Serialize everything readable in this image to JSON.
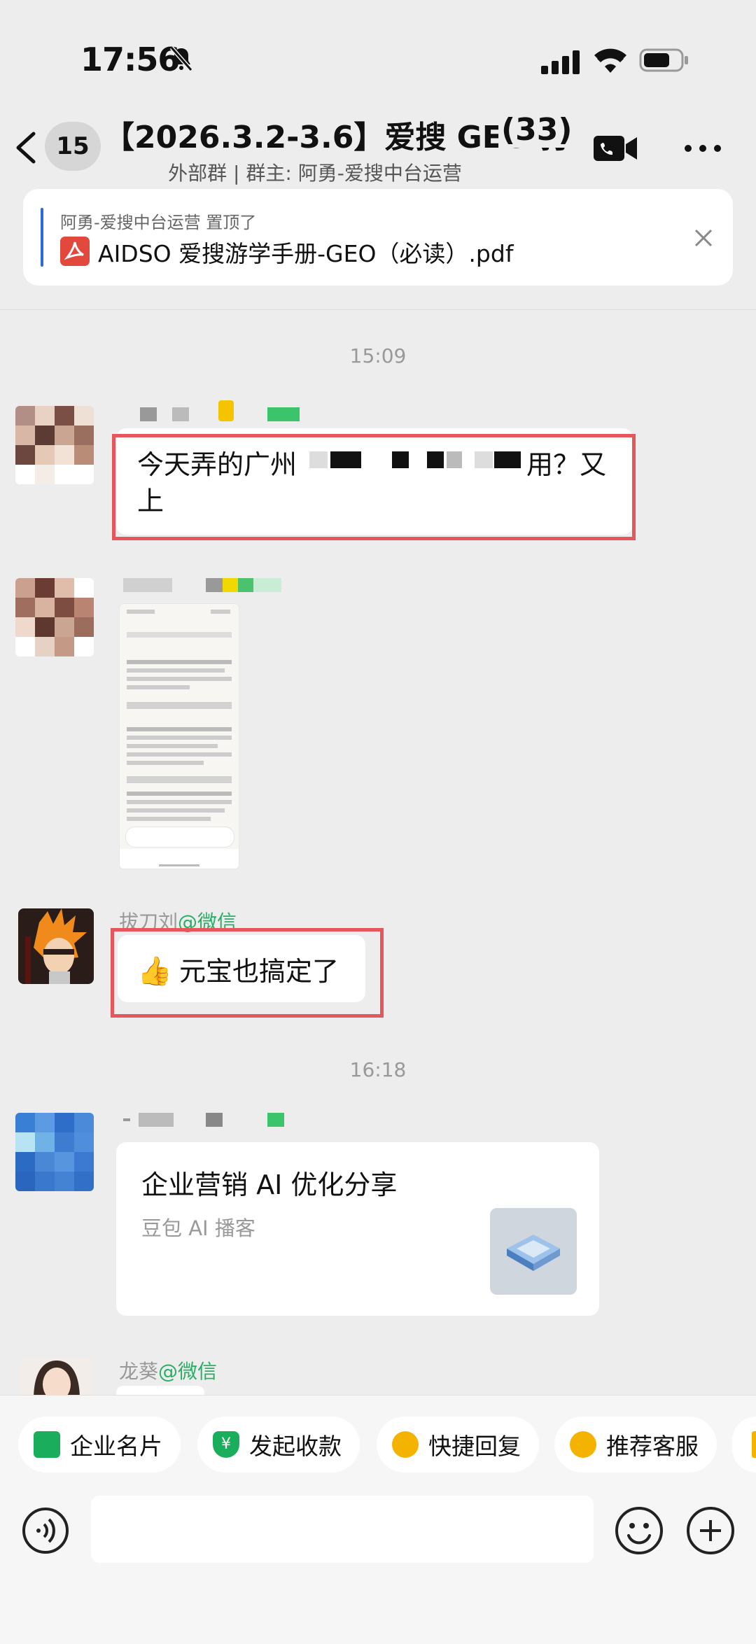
{
  "status_bar": {
    "time": "17:56"
  },
  "nav": {
    "unread_count": "15",
    "title": "【2026.3.2-3.6】爱搜 GEO 打",
    "member_count": "(33)",
    "subtitle": "外部群 | 群主: 阿勇-爱搜中台运营"
  },
  "pinned": {
    "meta": "阿勇-爱搜中台运营 置顶了",
    "file": "AIDSO 爱搜游学手册-GEO（必读）.pdf"
  },
  "timestamps": [
    "15:09",
    "16:18"
  ],
  "messages": [
    {
      "text_left": "今天弄的广州",
      "text_right": "用？又",
      "text_line2": "上"
    },
    {
      "type": "image"
    },
    {
      "sender": "拔刀刘",
      "sender_org": "@微信",
      "emoji": "👍",
      "text": "元宝也搞定了"
    },
    {
      "card_title": "企业营销 AI 优化分享",
      "card_source": "豆包 AI 播客"
    },
    {
      "sender": "龙葵",
      "sender_org": "@微信"
    }
  ],
  "toolbar": {
    "items": [
      {
        "label": "企业名片",
        "icon": "business-card-icon",
        "color": "#1aad5b"
      },
      {
        "label": "发起收款",
        "icon": "payment-icon",
        "color": "#1aad5b"
      },
      {
        "label": "快捷回复",
        "icon": "quick-reply-icon",
        "color": "#f5b301"
      },
      {
        "label": "推荐客服",
        "icon": "customer-service-icon",
        "color": "#f5b301"
      }
    ]
  },
  "colors": {
    "accent_green": "#2aae67",
    "highlight_red": "#e5575c",
    "pin_blue": "#2b6ad9"
  }
}
